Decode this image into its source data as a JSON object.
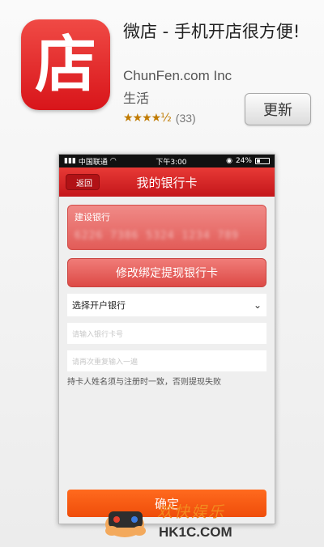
{
  "app": {
    "icon_glyph": "店",
    "title": "微店 - 手机开店很方便!",
    "developer": "ChunFen.com Inc",
    "category": "生活",
    "stars": "★★★★½",
    "rating_count": "(33)",
    "update_label": "更新"
  },
  "phone": {
    "status": {
      "carrier": "中国联通",
      "time": "下午3:00",
      "battery": "24%"
    },
    "nav": {
      "back_label": "返回",
      "title": "我的银行卡"
    },
    "card": {
      "bank_name": "建设银行",
      "number": "6226 7386 5324 1234 789"
    },
    "modify_label": "修改绑定提现银行卡",
    "select_bank": "选择开户银行",
    "card_number_placeholder": "请输入银行卡号",
    "confirm_placeholder": "请再次重复输入一遍",
    "hint": "持卡人姓名须与注册时一致，否则提现失败",
    "confirm_label": "确定"
  },
  "watermark": {
    "cn": "欢快娱乐",
    "en": "HK1C.COM"
  },
  "colors": {
    "brand_red": "#d8151a",
    "confirm_orange": "#ef4d0a"
  }
}
